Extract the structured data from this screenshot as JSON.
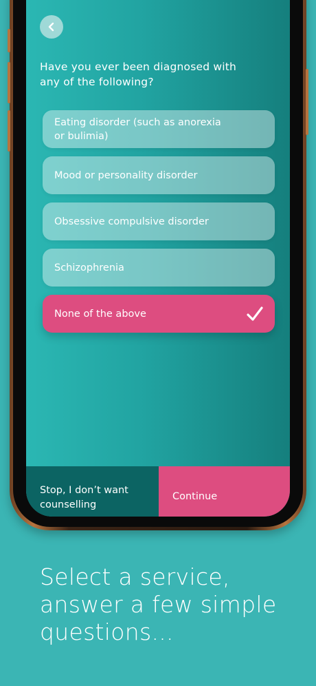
{
  "screen": {
    "question": "Have you ever been diagnosed with any of the following?",
    "options": [
      {
        "label": "Eating disorder (such as anorexia or bulimia)",
        "selected": false
      },
      {
        "label": "Mood or personality disorder",
        "selected": false
      },
      {
        "label": "Obsessive compulsive disorder",
        "selected": false
      },
      {
        "label": "Schizophrenia",
        "selected": false
      },
      {
        "label": "None of the above",
        "selected": true
      }
    ],
    "back_icon": "chevron-left-icon",
    "check_icon": "checkmark-icon",
    "footer": {
      "stop_label": "Stop, I don’t want counselling",
      "continue_label": "Continue"
    }
  },
  "caption": {
    "lines": [
      "Select a service,",
      "answer a few simple",
      "questions..."
    ]
  },
  "colors": {
    "background": "#3bb5b4",
    "accent_pink": "#dd4d80",
    "dark_teal": "#0c6463"
  }
}
